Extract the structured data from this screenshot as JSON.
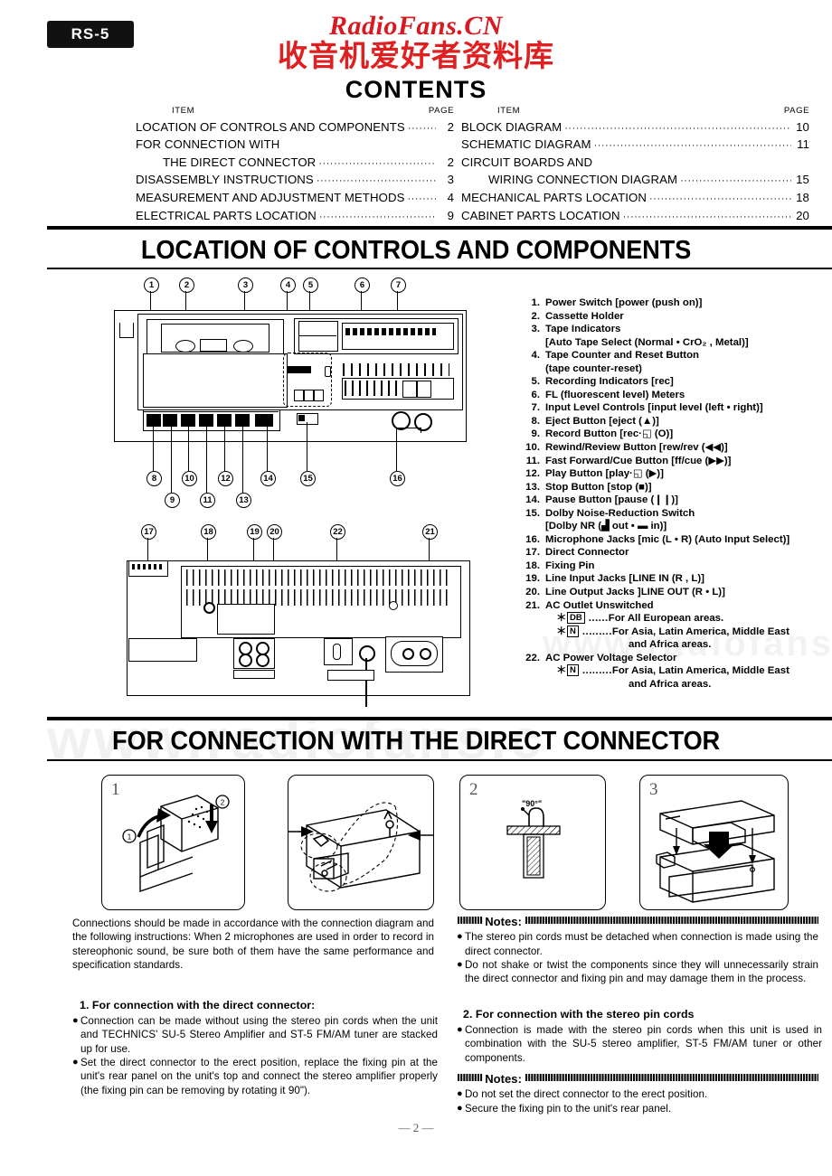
{
  "model_badge": "RS-5",
  "watermark": {
    "english": "RadioFans.CN",
    "chinese": "收音机爱好者资料库",
    "faint": "www.radiofans.c",
    "faint2": "www.radiofans.c"
  },
  "contents": {
    "title": "CONTENTS",
    "header_item": "ITEM",
    "header_page": "PAGE",
    "left": [
      {
        "label": "LOCATION OF CONTROLS AND COMPONENTS",
        "page": "2",
        "indent": false,
        "dots": true
      },
      {
        "label": "FOR CONNECTION WITH",
        "page": "",
        "indent": false,
        "dots": false
      },
      {
        "label": "THE DIRECT CONNECTOR",
        "page": "2",
        "indent": true,
        "dots": true
      },
      {
        "label": "DISASSEMBLY INSTRUCTIONS",
        "page": "3",
        "indent": false,
        "dots": true
      },
      {
        "label": "MEASUREMENT AND ADJUSTMENT METHODS",
        "page": "4",
        "indent": false,
        "dots": true
      },
      {
        "label": "ELECTRICAL PARTS LOCATION",
        "page": "9",
        "indent": false,
        "dots": true
      }
    ],
    "right": [
      {
        "label": "BLOCK DIAGRAM",
        "page": "10",
        "indent": false,
        "dots": true
      },
      {
        "label": "SCHEMATIC DIAGRAM",
        "page": "11",
        "indent": false,
        "dots": true
      },
      {
        "label": "CIRCUIT BOARDS AND",
        "page": "",
        "indent": false,
        "dots": false
      },
      {
        "label": "WIRING CONNECTION DIAGRAM",
        "page": "15",
        "indent": true,
        "dots": true
      },
      {
        "label": "MECHANICAL PARTS LOCATION",
        "page": "18",
        "indent": false,
        "dots": true
      },
      {
        "label": "CABINET PARTS LOCATION",
        "page": "20",
        "indent": false,
        "dots": true
      }
    ]
  },
  "section1": {
    "heading": "LOCATION OF CONTROLS AND COMPONENTS",
    "legend": [
      {
        "num": "1.",
        "text": "Power Switch [power (push on)]"
      },
      {
        "num": "2.",
        "text": "Cassette Holder"
      },
      {
        "num": "3.",
        "text": "Tape Indicators",
        "sub": "[Auto Tape Select (Normal • CrO₂ , Metal)]"
      },
      {
        "num": "4.",
        "text": "Tape Counter and Reset Button",
        "sub": "(tape counter-reset)"
      },
      {
        "num": "5.",
        "text": "Recording Indicators [rec]"
      },
      {
        "num": "6.",
        "text": "FL (fluorescent level) Meters"
      },
      {
        "num": "7.",
        "text": "Input Level Controls [input level (left • right)]"
      },
      {
        "num": "8.",
        "text": "Eject Button [eject (▲)]"
      },
      {
        "num": "9.",
        "text": "Record Button [rec·◱ (O)]"
      },
      {
        "num": "10.",
        "text": "Rewind/Review Button [rew/rev (◀◀)]"
      },
      {
        "num": "11.",
        "text": "Fast Forward/Cue Button [ff/cue (▶▶)]"
      },
      {
        "num": "12.",
        "text": "Play Button [play·◱ (▶)]"
      },
      {
        "num": "13.",
        "text": "Stop Button [stop (■)]"
      },
      {
        "num": "14.",
        "text": "Pause Button [pause (❙❙)]"
      },
      {
        "num": "15.",
        "text": "Dolby Noise-Reduction Switch",
        "sub": "[Dolby NR (▟ out • ▬ in)]"
      },
      {
        "num": "16.",
        "text": "Microphone Jacks [mic (L • R) (Auto Input Select)]"
      },
      {
        "num": "17.",
        "text": "Direct Connector"
      },
      {
        "num": "18.",
        "text": "Fixing Pin"
      },
      {
        "num": "19.",
        "text": "Line Input Jacks [LINE IN (R , L)]"
      },
      {
        "num": "20.",
        "text": "Line Output Jacks ]LINE OUT (R • L)]"
      },
      {
        "num": "21.",
        "text": "AC Outlet Unswitched"
      },
      {
        "num": "22.",
        "text": "AC Power Voltage Selector"
      }
    ],
    "area_notes_21": [
      {
        "star": "＊",
        "box": "DB",
        "dots": "......",
        "text": "For All European areas."
      },
      {
        "star": "＊",
        "box": "N",
        "dots": ".........",
        "text": "For Asia, Latin America, Middle East",
        "cont": "and Africa areas."
      }
    ],
    "area_notes_22": [
      {
        "star": "＊",
        "box": "N",
        "dots": ".........",
        "text": "For Asia, Latin America, Middle East",
        "cont": "and Africa areas."
      }
    ],
    "front_callouts": [
      "1",
      "2",
      "3",
      "4",
      "5",
      "6",
      "7",
      "8",
      "9",
      "10",
      "11",
      "12",
      "13",
      "14",
      "15",
      "16"
    ],
    "rear_callouts": [
      "17",
      "18",
      "19",
      "20",
      "21",
      "22"
    ]
  },
  "section2": {
    "heading": "FOR CONNECTION WITH THE DIRECT CONNECTOR",
    "boxes": [
      {
        "n": "1",
        "inner_labels": [
          "①",
          "②"
        ]
      },
      {
        "n": "",
        "inner_labels": []
      },
      {
        "n": "2",
        "inner_labels": [
          "\"90°\""
        ]
      },
      {
        "n": "3",
        "inner_labels": []
      }
    ],
    "intro": "Connections should be made in accordance with the connection diagram and the following instructions: When 2 microphones are used in order to record in stereophonic sound, be sure both of them have the same performance and specification standards.",
    "left_head": "1. For connection with the direct connector:",
    "left_bullets": [
      "Connection can be made without using the stereo pin cords when the unit and TECHNICS' SU-5 Stereo Amplifier and ST-5 FM/AM tuner are stacked up for use.",
      "Set the direct connector to the erect position, replace the fixing pin at the unit's rear panel on the unit's top and connect the stereo amplifier properly (the fixing pin can be removing by rotating it 90\")."
    ],
    "notes_label": "Notes:",
    "right_notes_1": [
      "The stereo pin cords must be detached when connection is made using the direct connector.",
      "Do not shake or twist the components since they will unnecessarily strain the direct connector and fixing pin and may damage them in the process."
    ],
    "right_head": "2. For connection with the stereo pin cords",
    "right_bullets": [
      "Connection is made with the stereo pin cords when this unit is used in combination with the SU-5 stereo amplifier, ST-5 FM/AM tuner or other components."
    ],
    "right_notes_2": [
      "Do not set the direct connector to the erect position.",
      "Secure the fixing pin to the unit's rear panel."
    ]
  },
  "footer": "— 2 —"
}
